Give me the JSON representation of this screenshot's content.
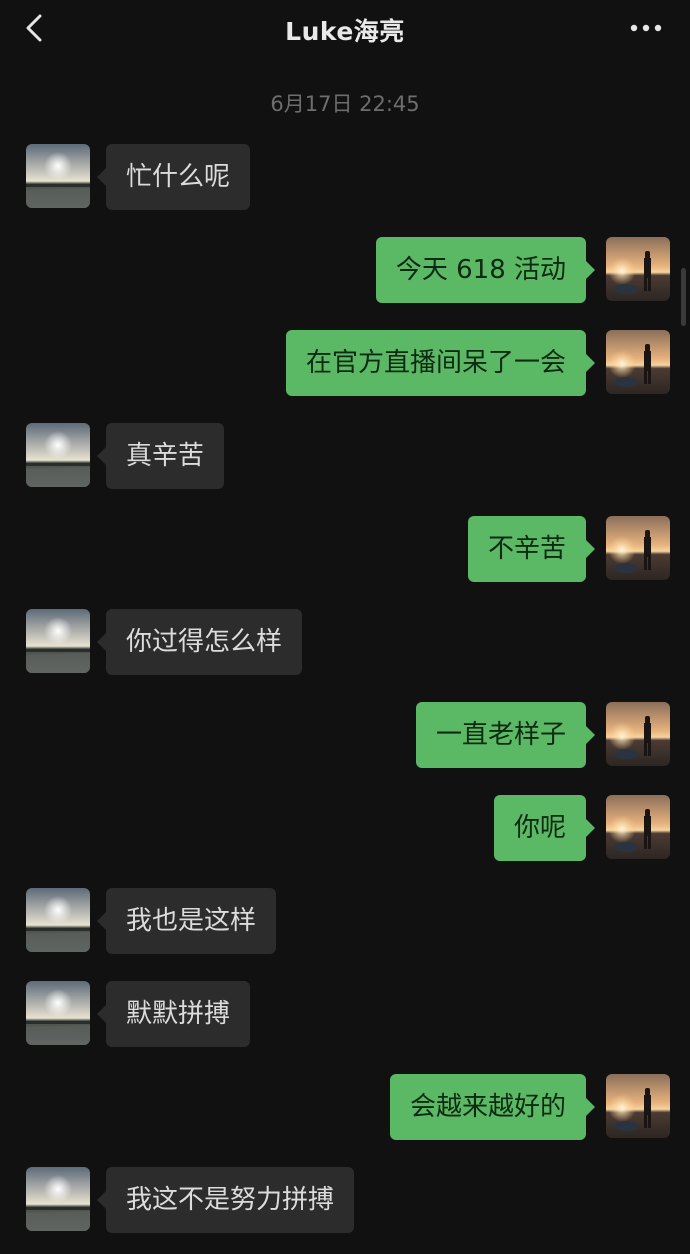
{
  "header": {
    "title": "Luke海亮",
    "back_icon": "chevron-left-icon",
    "more_icon": "more-dots-icon"
  },
  "timestamp": "6月17日 22:45",
  "colors": {
    "background": "#111111",
    "sent_bubble": "#5bb864",
    "received_bubble": "#2c2c2c"
  },
  "messages": [
    {
      "side": "left",
      "text": "忙什么呢"
    },
    {
      "side": "right",
      "text": "今天 618 活动"
    },
    {
      "side": "right",
      "text": "在官方直播间呆了一会"
    },
    {
      "side": "left",
      "text": "真辛苦"
    },
    {
      "side": "right",
      "text": "不辛苦"
    },
    {
      "side": "left",
      "text": "你过得怎么样"
    },
    {
      "side": "right",
      "text": "一直老样子"
    },
    {
      "side": "right",
      "text": "你呢"
    },
    {
      "side": "left",
      "text": "我也是这样"
    },
    {
      "side": "left",
      "text": "默默拼搏"
    },
    {
      "side": "right",
      "text": "会越来越好的"
    },
    {
      "side": "left",
      "text": "我这不是努力拼搏"
    }
  ]
}
